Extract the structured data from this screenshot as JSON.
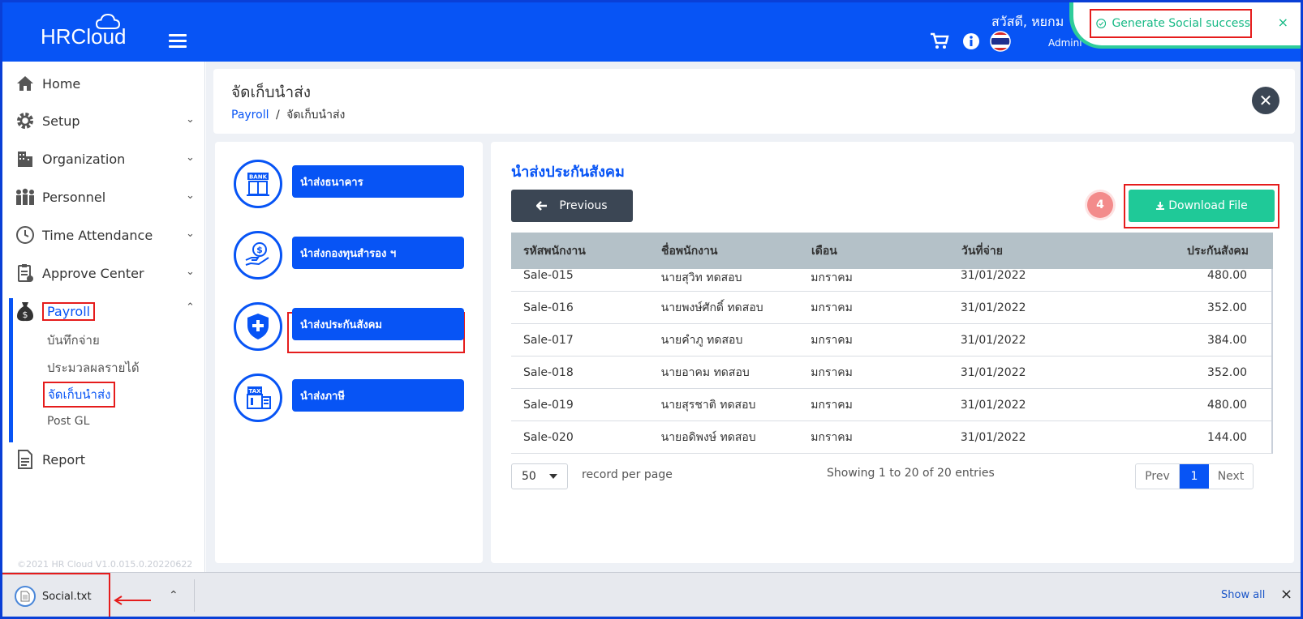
{
  "header": {
    "logo": "HRCloud",
    "greeting": "สวัสดี, หยกม",
    "user_role": "Admini"
  },
  "toast": {
    "message": "Generate Social success",
    "close": "×"
  },
  "sidebar": {
    "items": [
      {
        "label": "Home"
      },
      {
        "label": "Setup"
      },
      {
        "label": "Organization"
      },
      {
        "label": "Personnel"
      },
      {
        "label": "Time Attendance"
      },
      {
        "label": "Approve Center"
      },
      {
        "label": "Payroll"
      },
      {
        "label": "Report"
      }
    ],
    "payroll_sub": [
      {
        "label": "บันทึกจ่าย"
      },
      {
        "label": "ประมวลผลรายได้"
      },
      {
        "label": "จัดเก็บนำส่ง"
      },
      {
        "label": "Post GL"
      }
    ],
    "copyright": "©2021 HR Cloud V1.0.015.0.20220622"
  },
  "page": {
    "title": "จัดเก็บนำส่ง",
    "breadcrumb_link": "Payroll",
    "breadcrumb_sep": "/",
    "breadcrumb_current": "จัดเก็บนำส่ง"
  },
  "options": [
    {
      "label": "นำส่งธนาคาร",
      "icon": "bank-icon"
    },
    {
      "label": "นำส่งกองทุนสำรอง ฯ",
      "icon": "fund-icon"
    },
    {
      "label": "นำส่งประกันสังคม",
      "icon": "social-security-icon"
    },
    {
      "label": "นำส่งภาษี",
      "icon": "tax-icon"
    }
  ],
  "section": {
    "title": "นำส่งประกันสังคม",
    "previous_label": "Previous",
    "download_label": "Download File",
    "step": "4"
  },
  "table": {
    "headers": [
      "รหัสพนักงาน",
      "ชื่อพนักงาน",
      "เดือน",
      "วันที่จ่าย",
      "ประกันสังคม"
    ],
    "rows": [
      [
        "Sale-015",
        "นายสุวิท ทดสอบ",
        "มกราคม",
        "31/01/2022",
        "480.00"
      ],
      [
        "Sale-016",
        "นายพงษ์ศักดิ์ ทดสอบ",
        "มกราคม",
        "31/01/2022",
        "352.00"
      ],
      [
        "Sale-017",
        "นายคำภู ทดสอบ",
        "มกราคม",
        "31/01/2022",
        "384.00"
      ],
      [
        "Sale-018",
        "นายอาคม ทดสอบ",
        "มกราคม",
        "31/01/2022",
        "352.00"
      ],
      [
        "Sale-019",
        "นายสุรชาติ ทดสอบ",
        "มกราคม",
        "31/01/2022",
        "480.00"
      ],
      [
        "Sale-020",
        "นายอดิพงษ์ ทดสอบ",
        "มกราคม",
        "31/01/2022",
        "144.00"
      ]
    ]
  },
  "pagination": {
    "page_size": "50",
    "per_page_label": "record per page",
    "showing": "Showing 1 to 20 of 20 entries",
    "prev": "Prev",
    "current": "1",
    "next": "Next"
  },
  "download_bar": {
    "file_name": "Social.txt",
    "show_all": "Show all",
    "close": "×"
  },
  "colors": {
    "primary": "#0754f5",
    "success": "#1fc998",
    "dark": "#3b4654",
    "highlight": "#e51c1c"
  }
}
